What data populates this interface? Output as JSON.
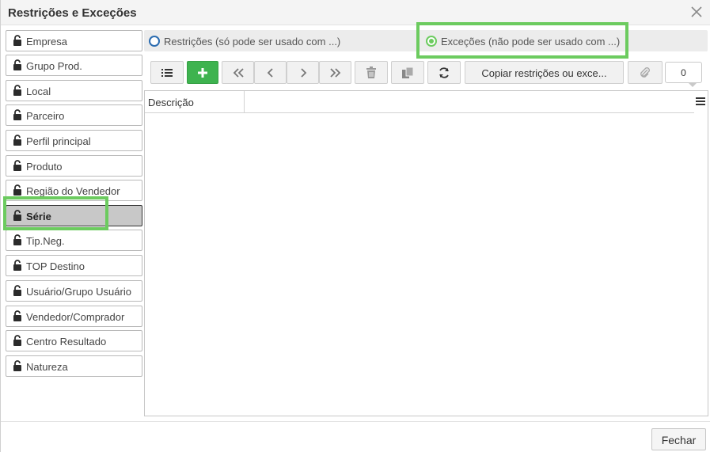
{
  "window": {
    "title": "Restrições e Exceções",
    "close_icon": "close-icon"
  },
  "sidebar": {
    "selected_index": 7,
    "items": [
      {
        "label": "Empresa"
      },
      {
        "label": "Grupo Prod."
      },
      {
        "label": "Local"
      },
      {
        "label": "Parceiro"
      },
      {
        "label": "Perfil principal"
      },
      {
        "label": "Produto"
      },
      {
        "label": "Região do Vendedor"
      },
      {
        "label": "Série"
      },
      {
        "label": "Tip.Neg."
      },
      {
        "label": "TOP Destino"
      },
      {
        "label": "Usuário/Grupo Usuário"
      },
      {
        "label": "Vendedor/Comprador"
      },
      {
        "label": "Centro Resultado"
      },
      {
        "label": "Natureza"
      }
    ]
  },
  "mode": {
    "restricoes_label": "Restrições (só pode ser usado com ...)",
    "excecoes_label": "Exceções (não pode ser usado com ...)",
    "selected": "excecoes"
  },
  "toolbar": {
    "copy_label": "Copiar restrições ou exce...",
    "attachment_count": "0"
  },
  "grid": {
    "columns": [
      "Descrição"
    ],
    "rows": []
  },
  "footer": {
    "close_label": "Fechar"
  },
  "colors": {
    "highlight": "#6ccb5f",
    "add_button": "#3eb34f",
    "radio_blue": "#2b6cb0"
  }
}
